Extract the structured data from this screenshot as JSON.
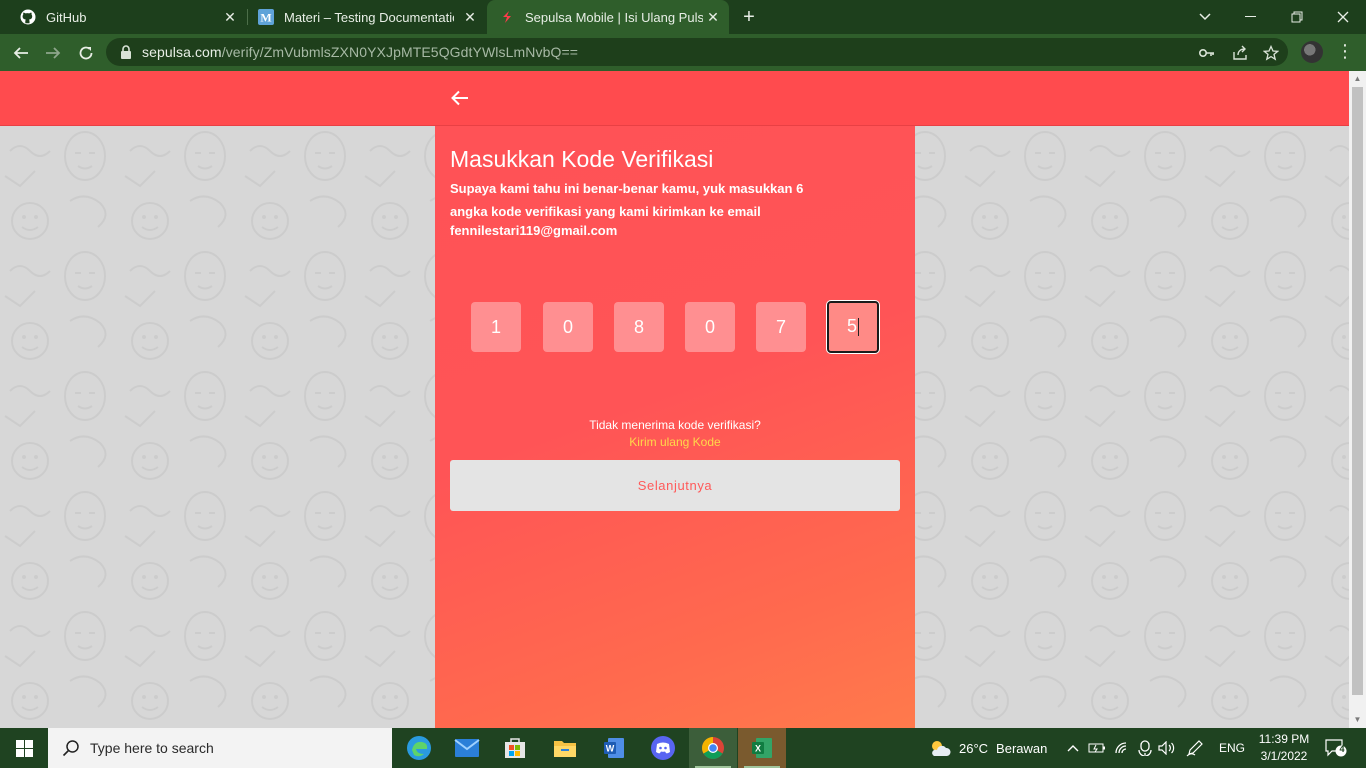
{
  "browser": {
    "tabs": [
      {
        "title": "GitHub",
        "icon": "github-icon",
        "active": false
      },
      {
        "title": "Materi – Testing Documentation",
        "icon": "medium-icon",
        "active": false
      },
      {
        "title": "Sepulsa Mobile | Isi Ulang Pulsa S",
        "icon": "sepulsa-icon",
        "active": true
      }
    ],
    "url_host": "sepulsa.com",
    "url_path": "/verify/ZmVubmlsZXN0YXJpMTE5QGdtYWlsLmNvbQ=="
  },
  "page": {
    "title": "Masukkan Kode Verifikasi",
    "description_line1": "Supaya kami tahu ini benar-benar kamu, yuk masukkan 6",
    "description_line2": "angka kode verifikasi yang kami kirimkan ke email",
    "email": "fennilestari119@gmail.com",
    "code_digits": [
      "1",
      "0",
      "8",
      "0",
      "7",
      "5"
    ],
    "resend_question": "Tidak menerima kode verifikasi?",
    "resend_link": "Kirim ulang Kode",
    "next_button": "Selanjutnya",
    "colors": {
      "primary": "#ff4b4e",
      "link": "#ffd84a",
      "button_bg": "#e4e4e4"
    }
  },
  "taskbar": {
    "search_placeholder": "Type here to search",
    "weather_temp": "26°C",
    "weather_desc": "Berawan",
    "language": "ENG",
    "time": "11:39 PM",
    "date": "3/1/2022",
    "notification_count": "4"
  }
}
